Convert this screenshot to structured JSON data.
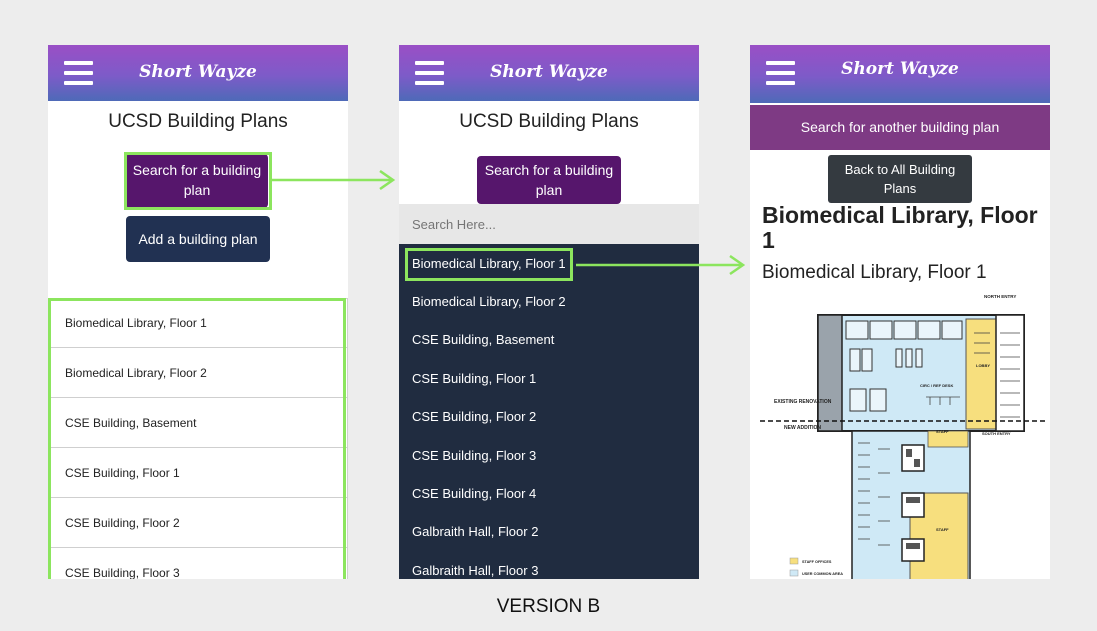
{
  "app": {
    "title": "Short Wayze"
  },
  "screen1": {
    "heading": "UCSD Building Plans",
    "search_button": "Search for a building plan",
    "add_button": "Add a building plan",
    "list": [
      "Biomedical Library, Floor 1",
      "Biomedical Library, Floor 2",
      "CSE Building, Basement",
      "CSE Building, Floor 1",
      "CSE Building, Floor 2",
      "CSE Building, Floor 3"
    ]
  },
  "screen2": {
    "heading": "UCSD Building Plans",
    "search_button": "Search for a building plan",
    "search_placeholder": "Search Here...",
    "list": [
      "Biomedical Library, Floor 1",
      "Biomedical Library, Floor 2",
      "CSE Building, Basement",
      "CSE Building, Floor 1",
      "CSE Building, Floor 2",
      "CSE Building, Floor 3",
      "CSE Building, Floor 4",
      "Galbraith Hall, Floor 2",
      "Galbraith Hall, Floor 3"
    ]
  },
  "screen3": {
    "another_button": "Search for another building plan",
    "back_button": "Back to All Building Plans",
    "title": "Biomedical Library, Floor 1",
    "subtitle": "Biomedical Library, Floor 1",
    "floorplan": {
      "labels": [
        "NORTH ENTRY",
        "LOBBY",
        "CIRC / REF DESK",
        "EXISTING RENOVATION",
        "NEW ADDITION",
        "STAFF",
        "SOUTH ENTRY",
        "STAFF",
        "STAFF OFFICES",
        "USER COMMON AREA"
      ]
    }
  },
  "caption": "VERSION B",
  "colors": {
    "highlight": "#8ce55e",
    "purple": "#56166c",
    "navy": "#213152",
    "dark_list": "#202c40"
  }
}
